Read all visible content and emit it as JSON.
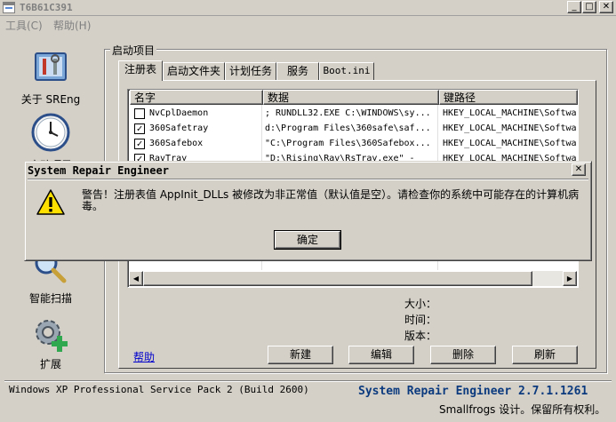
{
  "window": {
    "title": "T6B61C391"
  },
  "menu": [
    {
      "label": "工具(C)"
    },
    {
      "label": "帮助(H)"
    }
  ],
  "sidebar": [
    {
      "label": "关于 SREng",
      "icon": "toolbox-icon"
    },
    {
      "label": "启动项目",
      "icon": "clock-icon"
    },
    {
      "label": "智能扫描",
      "icon": "magnifier-icon"
    },
    {
      "label": "扩展",
      "icon": "gear-plus-icon"
    }
  ],
  "group_title": "启动项目",
  "tabs": [
    {
      "label": "注册表"
    },
    {
      "label": "启动文件夹"
    },
    {
      "label": "计划任务"
    },
    {
      "label": "服务"
    },
    {
      "label": "Boot.ini"
    }
  ],
  "columns": {
    "name": "名字",
    "data": "数据",
    "key": "键路径"
  },
  "rows": [
    {
      "checked": false,
      "name": "NvCplDaemon",
      "data": "; RUNDLL32.EXE C:\\WINDOWS\\sy...",
      "key": "HKEY_LOCAL_MACHINE\\Softwa"
    },
    {
      "checked": true,
      "name": "360Safetray",
      "data": "d:\\Program Files\\360safe\\saf...",
      "key": "HKEY_LOCAL_MACHINE\\Softwa"
    },
    {
      "checked": true,
      "name": "360Safebox",
      "data": "\"C:\\Program Files\\360Safebox...",
      "key": "HKEY_LOCAL_MACHINE\\Softwa"
    },
    {
      "checked": true,
      "name": "RavTray",
      "data": "\"D:\\Rising\\Rav\\RsTray.exe\" -",
      "key": "HKEY_LOCAL_MACHINE\\Softwa"
    }
  ],
  "info": {
    "size": "大小：",
    "time": "时间：",
    "version": "版本："
  },
  "buttons": {
    "help": "帮助",
    "new": "新建",
    "edit": "编辑",
    "delete": "删除",
    "refresh": "刷新"
  },
  "status": {
    "os": "Windows XP Professional Service Pack 2 (Build 2600)",
    "app_version": "System Repair Engineer 2.7.1.1261",
    "copyright": "Smallfrogs 设计。保留所有权利。"
  },
  "dialog": {
    "title": "System Repair Engineer",
    "message": "警告！注册表值 AppInit_DLLs 被修改为非正常值（默认值是空）。请检查你的系统中可能存在的计算机病毒。",
    "ok": "确定",
    "icon": "warning-icon"
  }
}
